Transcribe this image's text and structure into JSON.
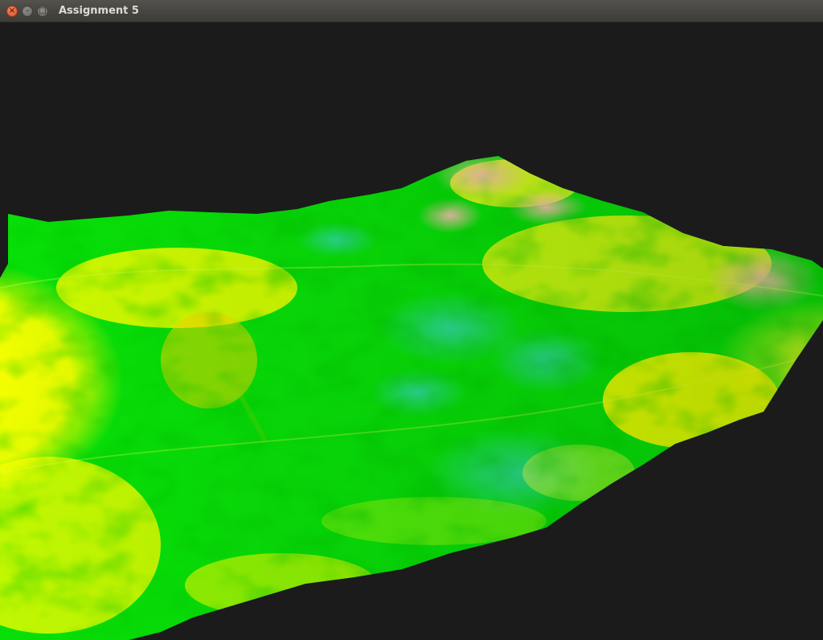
{
  "window": {
    "title": "Assignment 5",
    "buttons": {
      "close_icon": "close-icon",
      "minimize_icon": "minimize-icon",
      "maximize_icon": "maximize-icon"
    }
  },
  "viewport": {
    "background_color": "#1b1b1b",
    "content": "3D terrain heightmap",
    "palette": [
      "#00e000",
      "#30d890",
      "#ffff00",
      "#f0b8a0"
    ]
  }
}
